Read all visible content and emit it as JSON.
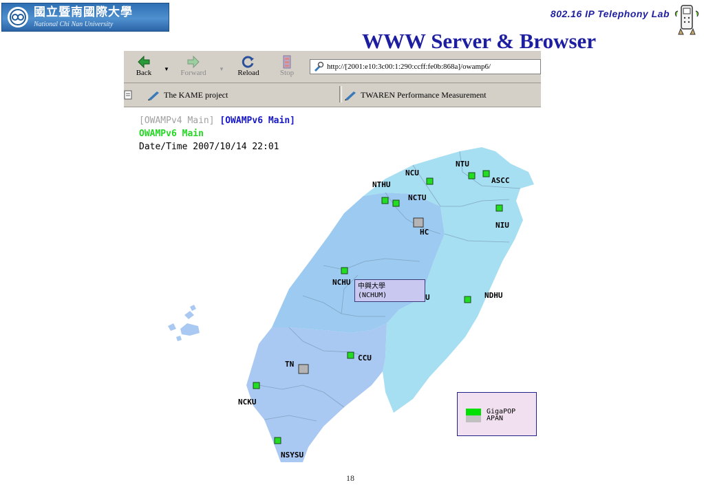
{
  "slide": {
    "logo_cn": "國立暨南國際大學",
    "logo_en": "National Chi Nan University",
    "lab": "802.16  IP  Telephony  Lab",
    "title": "WWW Server & Browser",
    "page_number": "18"
  },
  "browser": {
    "toolbar": {
      "back": "Back",
      "forward": "Forward",
      "reload": "Reload",
      "stop": "Stop",
      "address": "http://[2001:e10:3c00:1:290:ccff:fe0b:868a]/owamp6/"
    },
    "bookmarks": [
      {
        "label": "The KAME project"
      },
      {
        "label": "TWAREN Performance Measurement"
      }
    ]
  },
  "page": {
    "nav_v4": "[OWAMPv4 Main]",
    "nav_v6": "[OWAMPv6 Main]",
    "heading": "OWAMPv6 Main",
    "datetime": "Date/Time 2007/10/14 22:01"
  },
  "map": {
    "nodes": [
      {
        "label": "NTU",
        "kind": "GigaPOP"
      },
      {
        "label": "ASCC",
        "kind": "GigaPOP"
      },
      {
        "label": "NCU",
        "kind": "GigaPOP"
      },
      {
        "label": "NTHU",
        "kind": "GigaPOP"
      },
      {
        "label": "NCTU",
        "kind": "GigaPOP"
      },
      {
        "label": "HC",
        "kind": "APAN"
      },
      {
        "label": "NIU",
        "kind": "GigaPOP"
      },
      {
        "label": "NCHU",
        "kind": "GigaPOP"
      },
      {
        "label": "U",
        "kind": "label"
      },
      {
        "label": "NDHU",
        "kind": "GigaPOP"
      },
      {
        "label": "CCU",
        "kind": "GigaPOP"
      },
      {
        "label": "TN",
        "kind": "APAN"
      },
      {
        "label": "NCKU",
        "kind": "GigaPOP"
      },
      {
        "label": "NSYSU",
        "kind": "GigaPOP"
      }
    ],
    "tooltip": {
      "line1": "中興大學",
      "line2": "(NCHUM)"
    },
    "legend": [
      {
        "label": "GigaPOP",
        "color": "#00e000"
      },
      {
        "label": "APAN",
        "color": "#c0c0c0"
      }
    ],
    "colors": {
      "north": "#a6def2",
      "central": "#9ccaf0",
      "south": "#a9c8f2",
      "node_green": "#22dd22",
      "node_gray": "#b4b4b4"
    }
  }
}
